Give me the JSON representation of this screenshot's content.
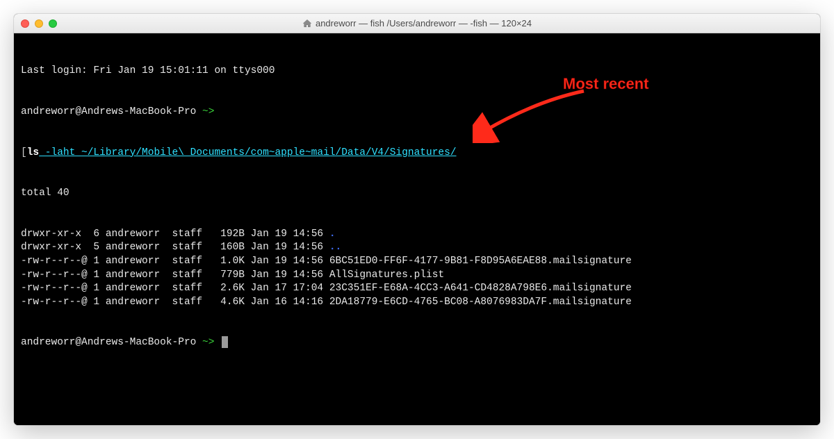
{
  "window": {
    "title": "andreworr — fish  /Users/andreworr — -fish — 120×24"
  },
  "terminal": {
    "last_login": "Last login: Fri Jan 19 15:01:11 on ttys000",
    "prompt_user_host": "andreworr@Andrews-MacBook-Pro",
    "prompt_path": "~",
    "prompt_arrow": ">",
    "cmd_open_bracket": "[",
    "cmd_ls": "ls",
    "cmd_flags": " -laht ",
    "cmd_path": "~/Library/Mobile\\ Documents/com~apple~mail/Data/V4/Signatures/",
    "total_line": "total 40",
    "rows": [
      {
        "perm": "drwxr-xr-x ",
        "links": " 6",
        "owner": " andreworr",
        "group": "  staff",
        "size": "   192B",
        "date": " Jan 19 14:56 ",
        "name": ".",
        "name_class": "bluebold"
      },
      {
        "perm": "drwxr-xr-x ",
        "links": " 5",
        "owner": " andreworr",
        "group": "  staff",
        "size": "   160B",
        "date": " Jan 19 14:56 ",
        "name": "..",
        "name_class": "bluebold"
      },
      {
        "perm": "-rw-r--r--@",
        "links": " 1",
        "owner": " andreworr",
        "group": "  staff",
        "size": "   1.0K",
        "date": " Jan 19 14:56 ",
        "name": "6BC51ED0-FF6F-4177-9B81-F8D95A6EAE88.mailsignature",
        "name_class": ""
      },
      {
        "perm": "-rw-r--r--@",
        "links": " 1",
        "owner": " andreworr",
        "group": "  staff",
        "size": "   779B",
        "date": " Jan 19 14:56 ",
        "name": "AllSignatures.plist",
        "name_class": ""
      },
      {
        "perm": "-rw-r--r--@",
        "links": " 1",
        "owner": " andreworr",
        "group": "  staff",
        "size": "   2.6K",
        "date": " Jan 17 17:04 ",
        "name": "23C351EF-E68A-4CC3-A641-CD4828A798E6.mailsignature",
        "name_class": ""
      },
      {
        "perm": "-rw-r--r--@",
        "links": " 1",
        "owner": " andreworr",
        "group": "  staff",
        "size": "   4.6K",
        "date": " Jan 16 14:16 ",
        "name": "2DA18779-E6CD-4765-BC08-A8076983DA7F.mailsignature",
        "name_class": ""
      }
    ]
  },
  "annotation": {
    "label": "Most recent"
  }
}
